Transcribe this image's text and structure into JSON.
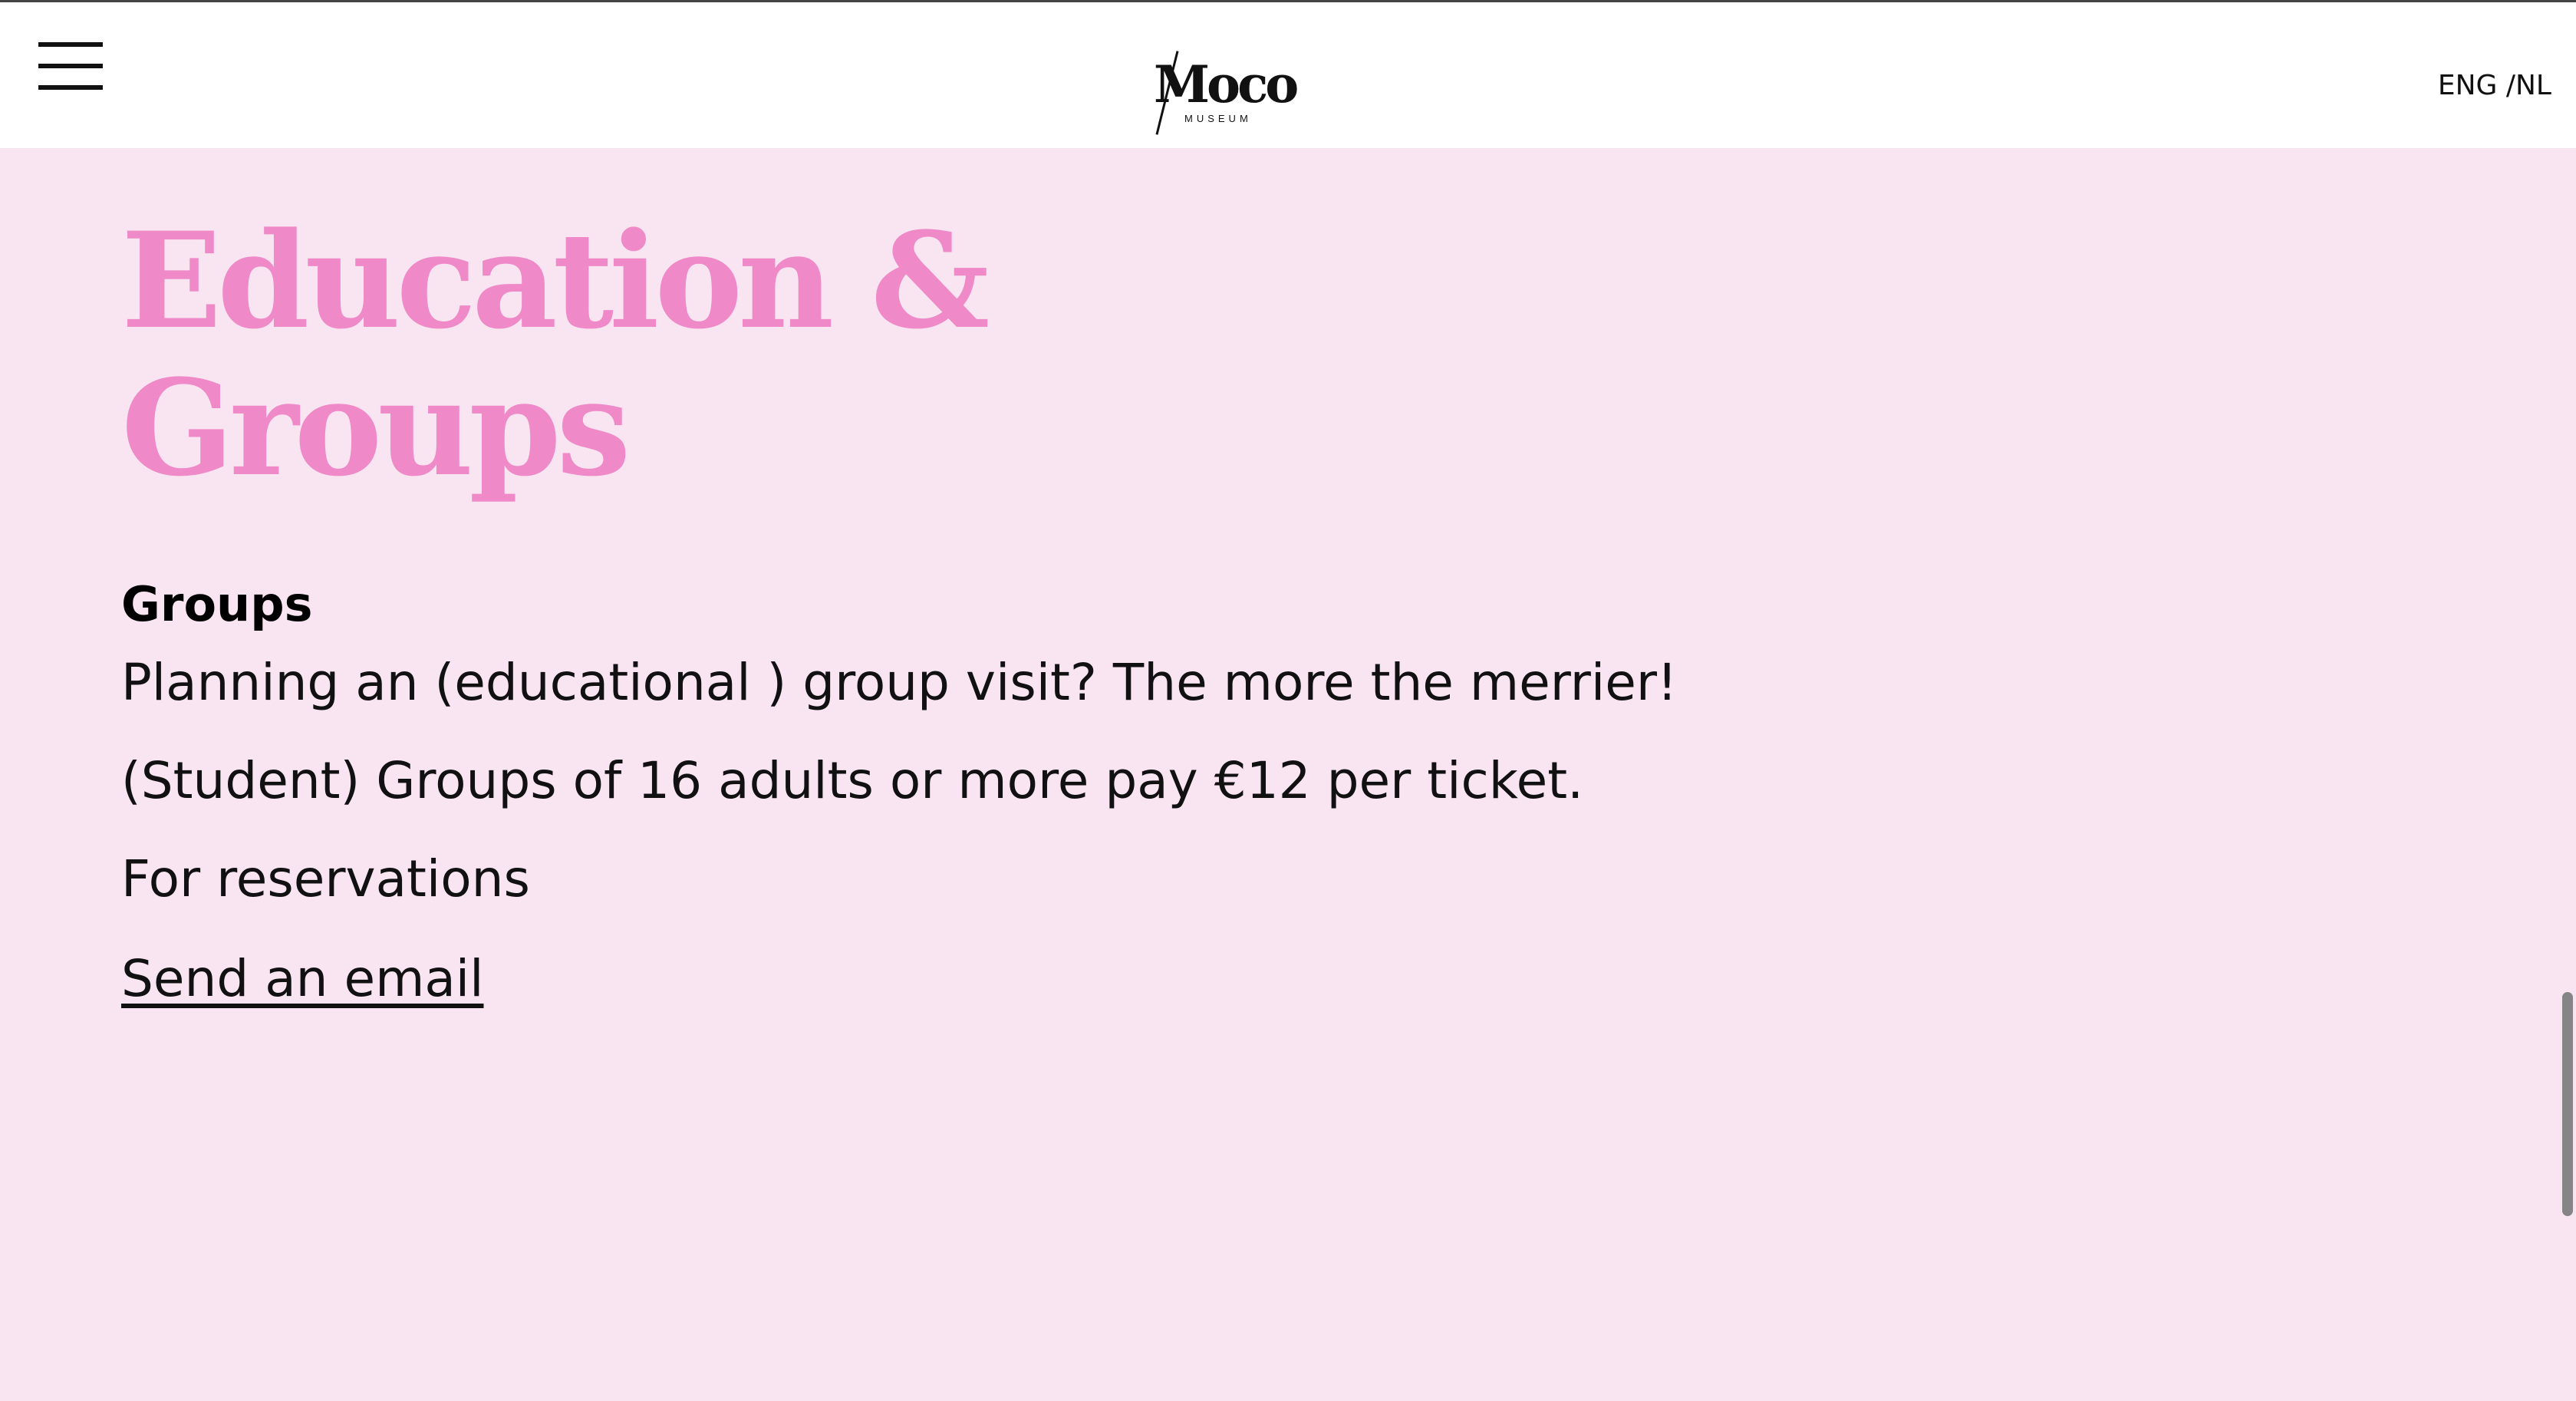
{
  "header": {
    "logo_main": "Moco",
    "logo_sub": "MUSEUM",
    "language": "ENG /NL"
  },
  "main": {
    "title_line1": "Education &",
    "title_line2": "Groups",
    "section_heading": "Groups",
    "paragraph1": "Planning an (educational ) group visit? The more the merrier!",
    "paragraph2": "(Student) Groups of 16 adults or more pay €12 per ticket.",
    "paragraph3": "For reservations",
    "email_link": "Send an email"
  },
  "colors": {
    "background": "#f9e5f1",
    "title_pink": "#ef89c7",
    "header_bg": "#ffffff",
    "text": "#111111"
  },
  "icons": {
    "menu": "hamburger-menu-icon"
  }
}
